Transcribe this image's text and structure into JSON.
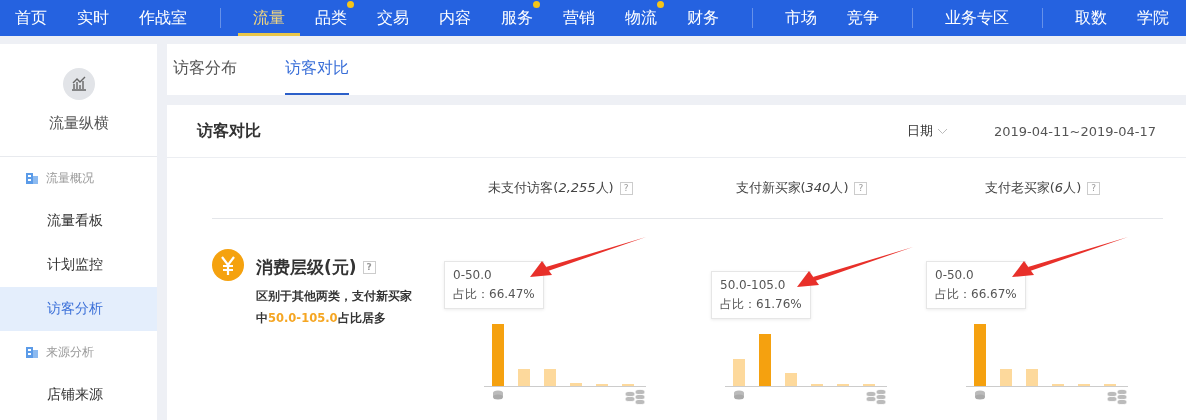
{
  "top_nav": {
    "groups": [
      [
        {
          "label": "首页",
          "selected": false,
          "dot": false
        },
        {
          "label": "实时",
          "selected": false,
          "dot": false
        },
        {
          "label": "作战室",
          "selected": false,
          "dot": false
        }
      ],
      [
        {
          "label": "流量",
          "selected": true,
          "dot": false
        },
        {
          "label": "品类",
          "selected": false,
          "dot": true
        },
        {
          "label": "交易",
          "selected": false,
          "dot": false
        },
        {
          "label": "内容",
          "selected": false,
          "dot": false
        },
        {
          "label": "服务",
          "selected": false,
          "dot": true
        },
        {
          "label": "营销",
          "selected": false,
          "dot": false
        },
        {
          "label": "物流",
          "selected": false,
          "dot": true
        },
        {
          "label": "财务",
          "selected": false,
          "dot": false
        }
      ],
      [
        {
          "label": "市场",
          "selected": false,
          "dot": false
        },
        {
          "label": "竞争",
          "selected": false,
          "dot": false
        }
      ],
      [
        {
          "label": "业务专区",
          "selected": false,
          "dot": false
        }
      ],
      [
        {
          "label": "取数",
          "selected": false,
          "dot": false
        },
        {
          "label": "学院",
          "selected": false,
          "dot": false
        }
      ]
    ]
  },
  "sidebar": {
    "title": "流量纵横",
    "sections": [
      {
        "label": "流量概况",
        "items": [
          {
            "label": "流量看板",
            "selected": false
          },
          {
            "label": "计划监控",
            "selected": false
          },
          {
            "label": "访客分析",
            "selected": true
          }
        ]
      },
      {
        "label": "来源分析",
        "items": [
          {
            "label": "店铺来源",
            "selected": false
          }
        ]
      }
    ]
  },
  "tabs": [
    {
      "label": "访客分布",
      "selected": false
    },
    {
      "label": "访客对比",
      "selected": true
    }
  ],
  "card": {
    "title": "访客对比",
    "date_label": "日期",
    "date_range": "2019-04-11~2019-04-17",
    "metric": {
      "title": "消费层级(元)",
      "help": "?",
      "description": "区别于其他两类，支付新买家中**50.0-105.0**占比居多"
    },
    "columns": [
      {
        "header": {
          "prefix": "未支付访客(",
          "count": "2,255",
          "suffix": "人)"
        },
        "help": "?",
        "tooltip": {
          "range": "0-50.0",
          "share": "占比：66.47%"
        },
        "bars": [
          {
            "selected": true
          },
          {
            "selected": false
          },
          {
            "selected": false
          },
          {
            "selected": false
          },
          {
            "selected": false
          },
          {
            "selected": false
          }
        ]
      },
      {
        "header": {
          "prefix": "支付新买家(",
          "count": "340",
          "suffix": "人)"
        },
        "help": "?",
        "tooltip": {
          "range": "50.0-105.0",
          "share": "占比：61.76%"
        },
        "bars": [
          {
            "selected": false
          },
          {
            "selected": true
          },
          {
            "selected": false
          },
          {
            "selected": false
          },
          {
            "selected": false
          },
          {
            "selected": false
          }
        ]
      },
      {
        "header": {
          "prefix": "支付老买家(",
          "count": "6",
          "suffix": "人)"
        },
        "help": "?",
        "tooltip": {
          "range": "0-50.0",
          "share": "占比：66.67%"
        },
        "bars": [
          {
            "selected": true
          },
          {
            "selected": false
          },
          {
            "selected": false
          },
          {
            "selected": false
          },
          {
            "selected": false
          },
          {
            "selected": false
          }
        ]
      }
    ]
  }
}
